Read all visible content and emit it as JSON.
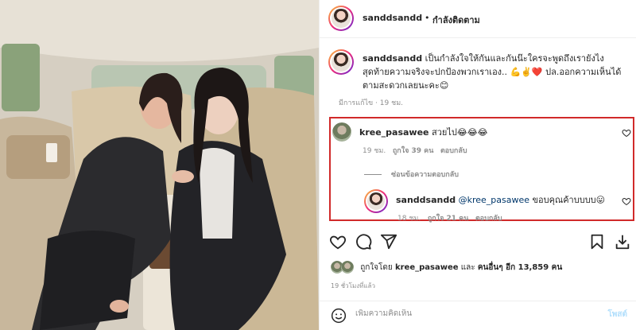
{
  "post": {
    "author": "sanddsandd",
    "separator": "•",
    "follow_status": "กำลังติดตาม",
    "caption": "เป็นกำลังใจให้กันและกันน๊ะใครจะพูดถึงเรายังไงสุดท้ายความจริงจะปกป้องพวกเราเอง.. 💪✌️❤️ ปล.ออกความเห็นได้ตามสะดวกเลยนะคะ😊",
    "caption_meta": "มีการแก้ไข · 19 ชม."
  },
  "comments": [
    {
      "user": "kree_pasawee",
      "text": "สวยไป😂😂😂",
      "time": "19 ชม.",
      "likes": "ถูกใจ 39 คน",
      "reply_label": "ตอบกลับ",
      "hide_replies": "ซ่อนข้อความตอบกลับ"
    },
    {
      "user": "sanddsandd",
      "mention": "@kree_pasawee",
      "text": "ขอบคุณค้าบบบบ😛",
      "time": "18 ชม.",
      "likes": "ถูกใจ 21 คน",
      "reply_label": "ตอบกลับ"
    }
  ],
  "actions": {
    "like_icon": "heart-icon",
    "comment_icon": "comment-icon",
    "share_icon": "share-icon",
    "save_icon": "bookmark-icon",
    "download_icon": "download-icon"
  },
  "likes_summary": {
    "prefix": "ถูกใจโดย",
    "user": "kree_pasawee",
    "middle": "และ",
    "others": "คนอื่นๆ อีก 13,859 คน"
  },
  "time_ago": "19 ชั่วโมงที่แล้ว",
  "add_comment": {
    "placeholder": "เพิ่มความคิดเห็น",
    "post_label": "โพสต์"
  },
  "colors": {
    "highlight_border": "#d12a2a",
    "post_button": "#b2dffc",
    "muted_text": "#8e8e8e"
  }
}
